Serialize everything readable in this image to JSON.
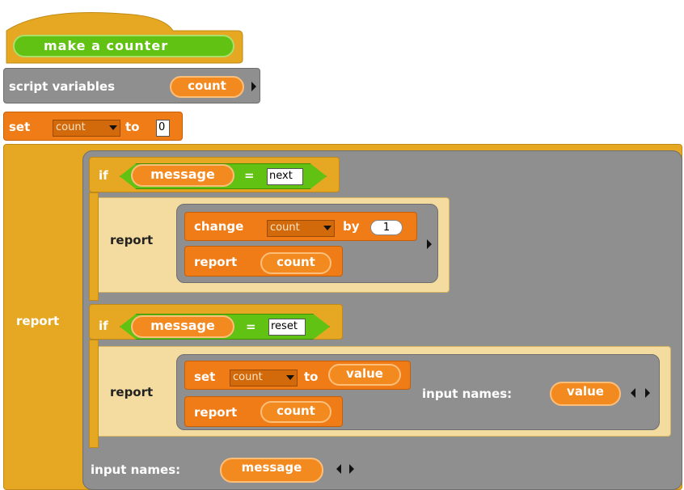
{
  "hat": {
    "label": "make a counter"
  },
  "script_vars": {
    "label": "script variables",
    "var": "count"
  },
  "set1": {
    "set": "set",
    "var": "count",
    "to": "to",
    "value": "0"
  },
  "outer_report": {
    "label": "report"
  },
  "if1": {
    "if": "if",
    "var": "message",
    "eq": "=",
    "value": "next",
    "report": "report",
    "change": "change",
    "var2": "count",
    "by": "by",
    "amount": "1",
    "report2": "report",
    "var3": "count"
  },
  "if2": {
    "if": "if",
    "var": "message",
    "eq": "=",
    "value": "reset",
    "report": "report",
    "set": "set",
    "var2": "count",
    "to": "to",
    "value2": "value",
    "report2": "report",
    "var3": "count",
    "input_names": "input names:",
    "param": "value"
  },
  "outer_ring": {
    "input_names": "input names:",
    "param": "message"
  },
  "colors": {
    "control": "#e6a822",
    "variables": "#f07c18",
    "operators": "#62c213",
    "other": "#8f8f8f"
  },
  "icons": {
    "right_arrow": "arrow-right-icon",
    "left_arrow": "arrow-left-icon",
    "dropdown": "dropdown-triangle-icon"
  }
}
